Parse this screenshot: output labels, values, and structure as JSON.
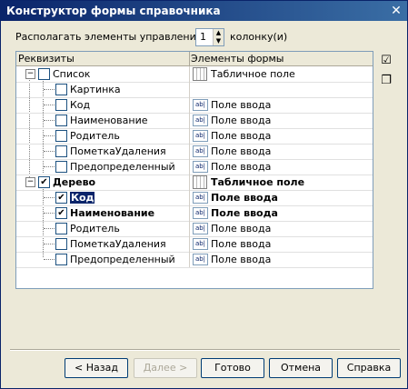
{
  "window": {
    "title": "Конструктор формы справочника",
    "close": "✕"
  },
  "columns_setting": {
    "label": "Располагать элементы управления в",
    "value": "1",
    "suffix": "колонку(и)"
  },
  "grid": {
    "headers": {
      "requisites": "Реквизиты",
      "elements": "Элементы формы"
    },
    "rows": [
      {
        "label": "Список",
        "expander": "−",
        "checked": false,
        "bold": false,
        "element": "Табличное поле",
        "element_icon": "table-icon",
        "icon_text": ""
      },
      {
        "label": "Картинка",
        "expander": "",
        "checked": false,
        "bold": false,
        "element": "",
        "element_icon": "",
        "icon_text": ""
      },
      {
        "label": "Код",
        "expander": "",
        "checked": false,
        "bold": false,
        "element": "Поле ввода",
        "element_icon": "input-field-icon",
        "icon_text": "ab|"
      },
      {
        "label": "Наименование",
        "expander": "",
        "checked": false,
        "bold": false,
        "element": "Поле ввода",
        "element_icon": "input-field-icon",
        "icon_text": "ab|"
      },
      {
        "label": "Родитель",
        "expander": "",
        "checked": false,
        "bold": false,
        "element": "Поле ввода",
        "element_icon": "input-field-icon",
        "icon_text": "ab|"
      },
      {
        "label": "ПометкаУдаления",
        "expander": "",
        "checked": false,
        "bold": false,
        "element": "Поле ввода",
        "element_icon": "input-field-icon",
        "icon_text": "ab|"
      },
      {
        "label": "Предопределенный",
        "expander": "",
        "checked": false,
        "bold": false,
        "element": "Поле ввода",
        "element_icon": "input-field-icon",
        "icon_text": "ab|"
      },
      {
        "label": "Дерево",
        "expander": "−",
        "checked": true,
        "bold": true,
        "element": "Табличное поле",
        "element_icon": "table-icon",
        "icon_text": ""
      },
      {
        "label": "Код",
        "expander": "",
        "checked": true,
        "bold": true,
        "selected": true,
        "element": "Поле ввода",
        "element_icon": "input-field-icon",
        "icon_text": "ab|"
      },
      {
        "label": "Наименование",
        "expander": "",
        "checked": true,
        "bold": true,
        "element": "Поле ввода",
        "element_icon": "input-field-icon",
        "icon_text": "ab|"
      },
      {
        "label": "Родитель",
        "expander": "",
        "checked": false,
        "bold": false,
        "element": "Поле ввода",
        "element_icon": "input-field-icon",
        "icon_text": "ab|"
      },
      {
        "label": "ПометкаУдаления",
        "expander": "",
        "checked": false,
        "bold": false,
        "element": "Поле ввода",
        "element_icon": "input-field-icon",
        "icon_text": "ab|"
      },
      {
        "label": "Предопределенный",
        "expander": "",
        "checked": false,
        "bold": false,
        "element": "Поле ввода",
        "element_icon": "input-field-icon",
        "icon_text": "ab|"
      }
    ]
  },
  "side_tools": [
    {
      "icon": "check-all-icon"
    },
    {
      "icon": "copy-icon"
    }
  ],
  "buttons": {
    "back": "< Назад",
    "next": "Далее >",
    "finish": "Готово",
    "cancel": "Отмена",
    "help": "Справка"
  },
  "colors": {
    "title_bar": "#0a246a",
    "window_bg": "#ece9d8",
    "selection": "#0a246a"
  }
}
